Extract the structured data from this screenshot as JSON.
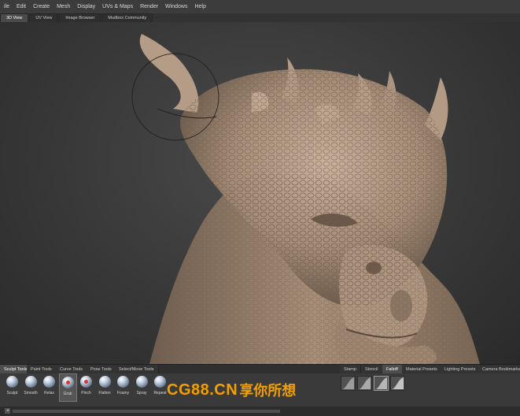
{
  "menubar": {
    "items": [
      "ile",
      "Edit",
      "Create",
      "Mesh",
      "Display",
      "UVs & Maps",
      "Render",
      "Windows",
      "Help"
    ]
  },
  "view_tabs": {
    "items": [
      {
        "label": "3D View",
        "active": true
      },
      {
        "label": "UV View",
        "active": false
      },
      {
        "label": "Image Browser",
        "active": false
      },
      {
        "label": "Mudbox Community",
        "active": false
      }
    ]
  },
  "tray_tabs": {
    "left": [
      {
        "label": "Sculpt Tools",
        "active": true
      },
      {
        "label": "Paint Tools",
        "active": false
      },
      {
        "label": "Curve Tools",
        "active": false
      },
      {
        "label": "Pose Tools",
        "active": false
      },
      {
        "label": "Select/Move Tools",
        "active": false
      }
    ],
    "right": [
      {
        "label": "Stamp",
        "active": false
      },
      {
        "label": "Stencil",
        "active": false
      },
      {
        "label": "Falloff",
        "active": true
      },
      {
        "label": "Material Presets",
        "active": false
      },
      {
        "label": "Lighting Presets",
        "active": false
      },
      {
        "label": "Camera Bookmarks",
        "active": false
      }
    ]
  },
  "sculpt_tools": [
    {
      "label": "Sculpt",
      "selected": false,
      "icon": "sculpt-icon"
    },
    {
      "label": "Smooth",
      "selected": false,
      "icon": "smooth-icon"
    },
    {
      "label": "Relax",
      "selected": false,
      "icon": "relax-icon"
    },
    {
      "label": "Grab",
      "selected": true,
      "icon": "grab-icon"
    },
    {
      "label": "Pinch",
      "selected": false,
      "icon": "pinch-icon"
    },
    {
      "label": "Flatten",
      "selected": false,
      "icon": "flatten-icon"
    },
    {
      "label": "Foamy",
      "selected": false,
      "icon": "foamy-icon"
    },
    {
      "label": "Spray",
      "selected": false,
      "icon": "spray-icon"
    },
    {
      "label": "Repeat",
      "selected": false,
      "icon": "repeat-icon"
    }
  ],
  "falloff_count": 4,
  "scroll": {
    "left_arrow": "◂"
  },
  "watermark": {
    "latin": "CG88.CN",
    "cjk": "享你所想"
  },
  "colors": {
    "accent": "#f2a000",
    "model": "#a88f78",
    "brush_ring": "#1c1c1c"
  }
}
